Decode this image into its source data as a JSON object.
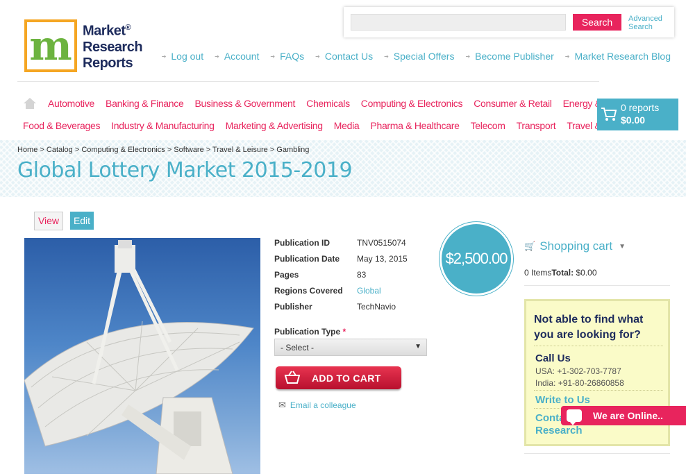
{
  "brand": {
    "name_line1": "Market",
    "name_line2": "Research",
    "name_line3": "Reports",
    "reg": "®",
    "logo_letter": "m"
  },
  "search": {
    "placeholder": "",
    "button": "Search",
    "advanced_line1": "Advanced",
    "advanced_line2": "Search"
  },
  "top_links": [
    "Log out",
    "Account",
    "FAQs",
    "Contact Us",
    "Special Offers",
    "Become Publisher",
    "Market Research Blog"
  ],
  "categories_row1": [
    "Automotive",
    "Banking & Finance",
    "Business & Government",
    "Chemicals",
    "Computing & Electronics",
    "Consumer & Retail",
    "Energy & Utilities"
  ],
  "categories_row2": [
    "Food & Beverages",
    "Industry & Manufacturing",
    "Marketing & Advertising",
    "Media",
    "Pharma & Healthcare",
    "Telecom",
    "Transport",
    "Travel & Leisure"
  ],
  "cart": {
    "count": "0 reports",
    "total": "$0.00"
  },
  "breadcrumb": "Home > Catalog > Computing & Electronics > Software > Travel & Leisure > Gambling",
  "page_title": "Global Lottery Market 2015-2019",
  "tabs": {
    "view": "View",
    "edit": "Edit"
  },
  "details": {
    "publication_id_label": "Publication ID",
    "publication_id": "TNV0515074",
    "publication_date_label": "Publication Date",
    "publication_date": "May 13, 2015",
    "pages_label": "Pages",
    "pages": "83",
    "regions_label": "Regions Covered",
    "regions": "Global",
    "publisher_label": "Publisher",
    "publisher": "TechNavio"
  },
  "publication_type": {
    "label": "Publication Type",
    "required": "*",
    "selected": "- Select -"
  },
  "add_to_cart": "ADD TO CART",
  "email_colleague": "Email a colleague",
  "price": "$2,500.00",
  "shopping_cart": {
    "title": "Shopping cart",
    "items": "0 Items",
    "total_label": "Total:",
    "total": " $0.00"
  },
  "help": {
    "title": "Not able to find what you are looking for?",
    "call_us": "Call Us",
    "usa": "USA: +1-302-703-7787",
    "india": "India: +91-80-26860858",
    "write_us": "Write to Us",
    "contact": "Contact Market Research"
  },
  "chat": "We are Online..",
  "colors": {
    "accent_pink": "#e8245d",
    "accent_blue": "#4ab0c8",
    "navy": "#1d2b5c"
  }
}
